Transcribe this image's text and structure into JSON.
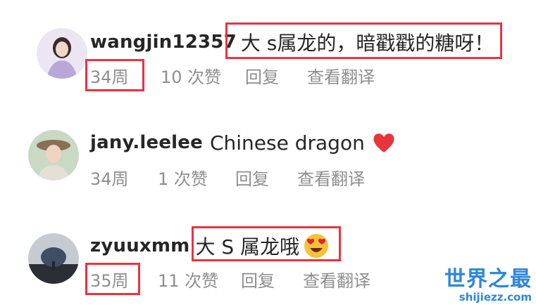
{
  "comments": [
    {
      "username": "wangjin12357",
      "text": "大 s属龙的，暗戳戳的糖呀！",
      "time": "34周",
      "likes": "10 次赞",
      "reply": "回复",
      "translate": "查看翻译"
    },
    {
      "username": "jany.leelee",
      "text": "Chinese dragon",
      "time": "34周",
      "likes": "1 次赞",
      "reply": "回复",
      "translate": "查看翻译",
      "emoji": "heart-icon"
    },
    {
      "username": "zyuuxmm",
      "text": "大 S 属龙哦",
      "time": "35周",
      "likes": "11 次赞",
      "reply": "回复",
      "translate": "查看翻译",
      "emoji": "heart-eyes-icon"
    }
  ],
  "watermark": {
    "title": "世界之最",
    "url": "shijiezz.com"
  },
  "colors": {
    "highlight": "#e8343f",
    "meta_text": "#8e8e8e",
    "watermark": "#2f87d8"
  }
}
